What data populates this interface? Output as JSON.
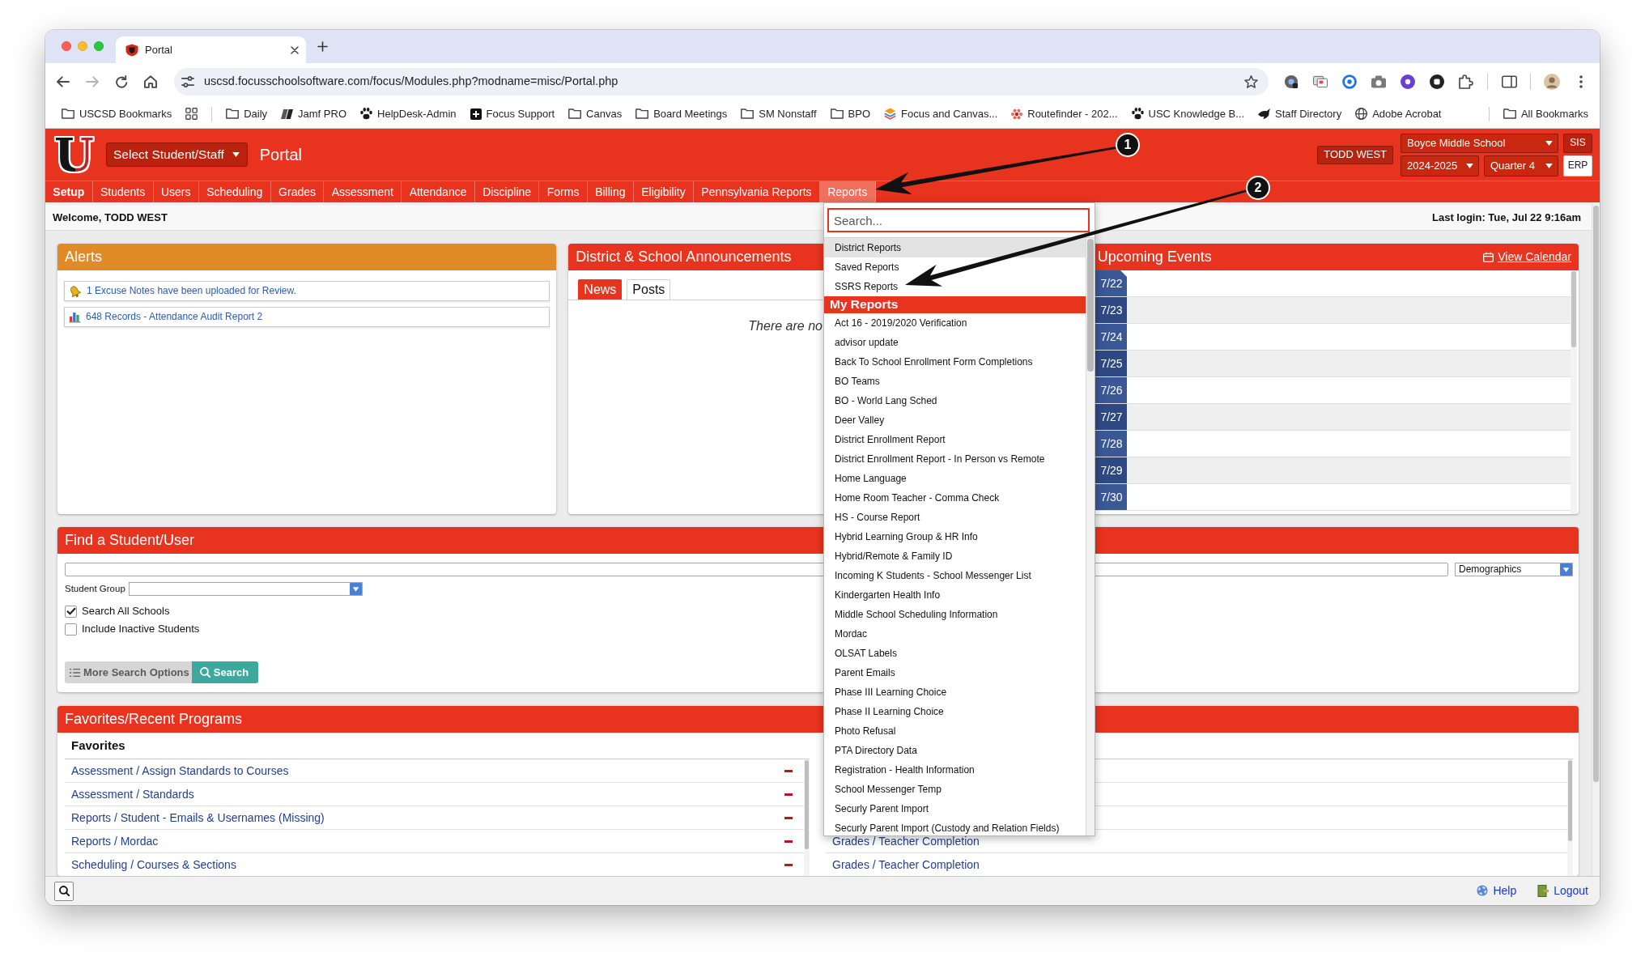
{
  "browser": {
    "tab_title": "Portal",
    "url": "uscsd.focusschoolsoftware.com/focus/Modules.php?modname=misc/Portal.php",
    "bookmarks": [
      {
        "kind": "folder",
        "label": "USCSD Bookmarks"
      },
      {
        "kind": "apps"
      },
      {
        "kind": "divider"
      },
      {
        "kind": "folder",
        "label": "Daily"
      },
      {
        "kind": "tile",
        "label": "Jamf PRO"
      },
      {
        "kind": "paw",
        "label": "HelpDesk-Admin"
      },
      {
        "kind": "plus",
        "label": "Focus Support"
      },
      {
        "kind": "folder",
        "label": "Canvas"
      },
      {
        "kind": "folder",
        "label": "Board Meetings"
      },
      {
        "kind": "folder",
        "label": "SM Nonstaff"
      },
      {
        "kind": "folder",
        "label": "BPO"
      },
      {
        "kind": "stack",
        "label": "Focus and Canvas..."
      },
      {
        "kind": "flower",
        "label": "Routefinder - 202..."
      },
      {
        "kind": "paw",
        "label": "USC Knowledge B..."
      },
      {
        "kind": "bird",
        "label": "Staff Directory"
      },
      {
        "kind": "globe",
        "label": "Adobe Acrobat"
      },
      {
        "kind": "divider"
      },
      {
        "kind": "folder",
        "label": "All Bookmarks"
      }
    ]
  },
  "header": {
    "logo": "U",
    "student_select": "Select Student/Staff",
    "title": "Portal",
    "user": "TODD WEST",
    "school": "Boyce Middle School",
    "year": "2024-2025",
    "term": "Quarter 4",
    "apps": [
      {
        "label": "SIS",
        "selected": true
      },
      {
        "label": "ERP",
        "selected": false
      }
    ]
  },
  "nav": [
    {
      "label": "Setup",
      "selected": true,
      "open": false
    },
    {
      "label": "Students",
      "selected": false,
      "open": false
    },
    {
      "label": "Users",
      "selected": false,
      "open": false
    },
    {
      "label": "Scheduling",
      "selected": false,
      "open": false
    },
    {
      "label": "Grades",
      "selected": false,
      "open": false
    },
    {
      "label": "Assessment",
      "selected": false,
      "open": false
    },
    {
      "label": "Attendance",
      "selected": false,
      "open": false
    },
    {
      "label": "Discipline",
      "selected": false,
      "open": false
    },
    {
      "label": "Forms",
      "selected": false,
      "open": false
    },
    {
      "label": "Billing",
      "selected": false,
      "open": false
    },
    {
      "label": "Eligibility",
      "selected": false,
      "open": false
    },
    {
      "label": "Pennsylvania Reports",
      "selected": false,
      "open": false
    },
    {
      "label": "Reports",
      "selected": false,
      "open": true
    }
  ],
  "reports_menu": {
    "search_placeholder": "Search...",
    "items": [
      {
        "label": "District Reports",
        "selected": true
      },
      {
        "label": "Saved Reports",
        "selected": false
      },
      {
        "label": "SSRS Reports",
        "selected": false
      }
    ],
    "my_reports": {
      "title": "My Reports",
      "items": [
        {
          "label": "Act 16 - 2019/2020 Verification",
          "selected": false
        },
        {
          "label": "advisor update",
          "selected": false
        },
        {
          "label": "Back To School Enrollment Form Completions",
          "selected": false
        },
        {
          "label": "BO Teams",
          "selected": false
        },
        {
          "label": "BO - World Lang Sched",
          "selected": false
        },
        {
          "label": "Deer Valley",
          "selected": false
        },
        {
          "label": "District Enrollment Report",
          "selected": false
        },
        {
          "label": "District Enrollment Report - In Person vs Remote",
          "selected": false
        },
        {
          "label": "Home Language",
          "selected": false
        },
        {
          "label": "Home Room Teacher - Comma Check",
          "selected": false
        },
        {
          "label": "HS - Course Report",
          "selected": false
        },
        {
          "label": "Hybrid Learning Group & HR Info",
          "selected": false
        },
        {
          "label": "Hybrid/Remote & Family ID",
          "selected": false
        },
        {
          "label": "Incoming K Students - School Messenger List",
          "selected": false
        },
        {
          "label": "Kindergarten Health Info",
          "selected": false
        },
        {
          "label": "Middle School Scheduling Information",
          "selected": false
        },
        {
          "label": "Mordac",
          "selected": false
        },
        {
          "label": "OLSAT Labels",
          "selected": false
        },
        {
          "label": "Parent Emails",
          "selected": false
        },
        {
          "label": "Phase III Learning Choice",
          "selected": false
        },
        {
          "label": "Phase II Learning Choice",
          "selected": false
        },
        {
          "label": "Photo Refusal",
          "selected": false
        },
        {
          "label": "PTA Directory Data",
          "selected": false
        },
        {
          "label": "Registration - Health Information",
          "selected": false
        },
        {
          "label": "School Messenger Temp",
          "selected": false
        },
        {
          "label": "Securly Parent Import",
          "selected": false
        },
        {
          "label": "Securly Parent Import (Custody and Relation Fields)",
          "selected": false
        }
      ]
    }
  },
  "welcome": "Welcome, TODD WEST",
  "last_login": "Last login: Tue, Jul 22 9:16am",
  "alerts": {
    "title": "Alerts",
    "items": [
      {
        "kind": "notice",
        "text": "1 Excuse Notes have been uploaded for Review."
      },
      {
        "kind": "report",
        "text": "648 Records - Attendance Audit Report 2"
      }
    ]
  },
  "announcements": {
    "title": "District & School Announcements",
    "tabs": [
      {
        "label": "News",
        "selected": true
      },
      {
        "label": "Posts",
        "selected": false
      }
    ],
    "message": "There are no"
  },
  "upcoming_events": {
    "title": "Upcoming Events",
    "link": "View Calendar",
    "dates": [
      {
        "label": "7/22",
        "today": true
      },
      {
        "label": "7/23",
        "today": false
      },
      {
        "label": "7/24",
        "today": false
      },
      {
        "label": "7/25",
        "today": false
      },
      {
        "label": "7/26",
        "today": false
      },
      {
        "label": "7/27",
        "today": false
      },
      {
        "label": "7/28",
        "today": false
      },
      {
        "label": "7/29",
        "today": false
      },
      {
        "label": "7/30",
        "today": false
      }
    ]
  },
  "find_user": {
    "title": "Find a Student/User",
    "category": "Demographics",
    "student_group": "Student Group",
    "options": [
      {
        "label": "Search All Schools",
        "checked": true
      },
      {
        "label": "Include Inactive Students",
        "checked": false
      }
    ],
    "buttons": [
      {
        "kind": "options",
        "label": "More Search Options"
      },
      {
        "kind": "search",
        "label": "Search"
      }
    ]
  },
  "favorites": {
    "title": "Favorites/Recent Programs",
    "heading": "Favorites",
    "favorites": [
      "Assessment / Assign Standards to Courses",
      "Assessment / Standards",
      "Reports / Student - Emails & Usernames (Missing)",
      "Reports / Mordac",
      "Scheduling / Courses & Sections"
    ],
    "recent": [
      "Grades / Teacher Completion",
      "Grades / Teacher Completion"
    ]
  },
  "footer": {
    "help": "Help",
    "logout": "Logout"
  },
  "annotations": [
    {
      "number": "1"
    },
    {
      "number": "2"
    }
  ]
}
